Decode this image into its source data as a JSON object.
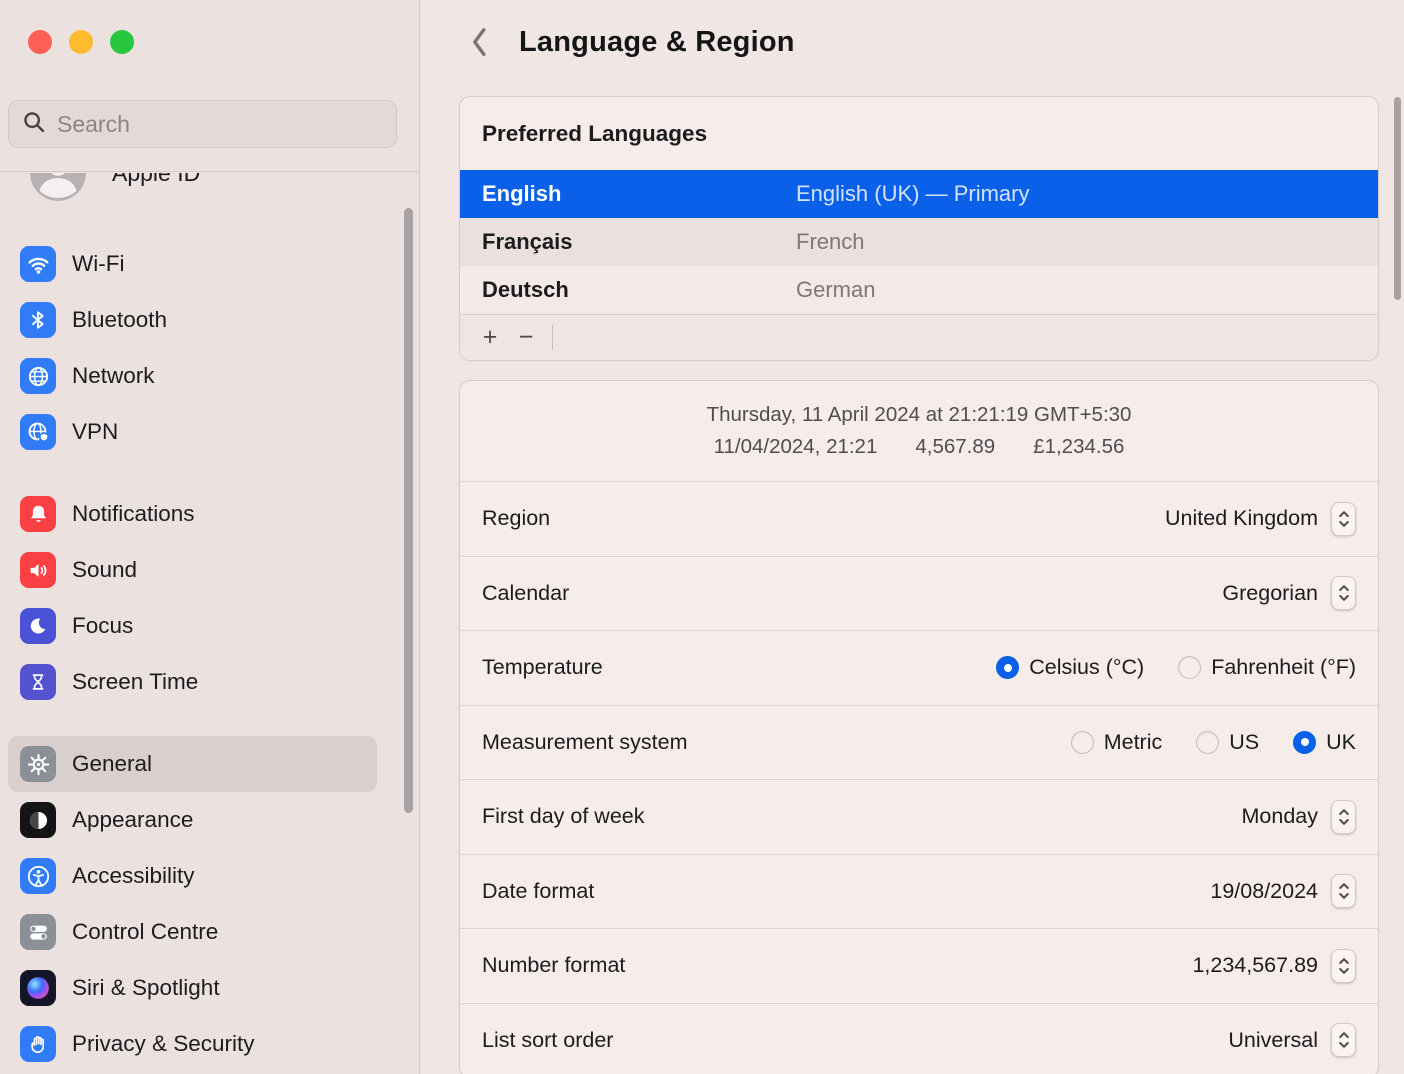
{
  "colors": {
    "accent": "#0a60e8",
    "traffic": [
      "#fe5f57",
      "#febb2e",
      "#27c83f"
    ],
    "selected_sidebar": "#d9d0ce"
  },
  "sidebar": {
    "search": {
      "placeholder": "Search"
    },
    "apple_id": {
      "label": "Apple ID"
    },
    "groups": [
      {
        "items": [
          {
            "id": "wifi",
            "label": "Wi-Fi",
            "icon": "wifi",
            "color": "#2f7cf6"
          },
          {
            "id": "bluetooth",
            "label": "Bluetooth",
            "icon": "bluetooth",
            "color": "#2f7cf6"
          },
          {
            "id": "network",
            "label": "Network",
            "icon": "globe",
            "color": "#2f7cf6"
          },
          {
            "id": "vpn",
            "label": "VPN",
            "icon": "vpn",
            "color": "#2f7cf6"
          }
        ]
      },
      {
        "items": [
          {
            "id": "notifications",
            "label": "Notifications",
            "icon": "bell",
            "color": "#fb4044"
          },
          {
            "id": "sound",
            "label": "Sound",
            "icon": "speaker",
            "color": "#fb4044"
          },
          {
            "id": "focus",
            "label": "Focus",
            "icon": "moon",
            "color": "#4a52d8"
          },
          {
            "id": "screen-time",
            "label": "Screen Time",
            "icon": "hourglass",
            "color": "#5453cf"
          }
        ]
      },
      {
        "items": [
          {
            "id": "general",
            "label": "General",
            "icon": "gear",
            "color": "#8b9096",
            "selected": true
          },
          {
            "id": "appearance",
            "label": "Appearance",
            "icon": "appearance",
            "color": "#141416"
          },
          {
            "id": "accessibility",
            "label": "Accessibility",
            "icon": "accessibility",
            "color": "#2f7cf6"
          },
          {
            "id": "control-centre",
            "label": "Control Centre",
            "icon": "toggles",
            "color": "#8b9096"
          },
          {
            "id": "siri",
            "label": "Siri & Spotlight",
            "icon": "siri",
            "color": "#14142a"
          },
          {
            "id": "privacy",
            "label": "Privacy & Security",
            "icon": "hand",
            "color": "#2f7cf6"
          }
        ]
      }
    ]
  },
  "main": {
    "header": {
      "title": "Language & Region"
    },
    "preferred_languages": {
      "title": "Preferred Languages",
      "languages": [
        {
          "name": "English",
          "detail": "English (UK) — Primary",
          "selected": true
        },
        {
          "name": "Français",
          "detail": "French",
          "selected": false
        },
        {
          "name": "Deutsch",
          "detail": "German",
          "selected": false
        }
      ],
      "toolbar": {
        "add": "+",
        "remove": "−"
      }
    },
    "formats": {
      "preview_line1": "Thursday, 11 April 2024 at 21:21:19 GMT+5:30",
      "preview_parts": [
        "11/04/2024, 21:21",
        "4,567.89",
        "£1,234.56"
      ],
      "rows": [
        {
          "label": "Region",
          "type": "stepper",
          "value": "United Kingdom"
        },
        {
          "label": "Calendar",
          "type": "stepper",
          "value": "Gregorian"
        },
        {
          "label": "Temperature",
          "type": "radio",
          "options": [
            {
              "label": "Celsius (°C)",
              "selected": true
            },
            {
              "label": "Fahrenheit (°F)",
              "selected": false
            }
          ]
        },
        {
          "label": "Measurement system",
          "type": "radio",
          "options": [
            {
              "label": "Metric",
              "selected": false
            },
            {
              "label": "US",
              "selected": false
            },
            {
              "label": "UK",
              "selected": true
            }
          ]
        },
        {
          "label": "First day of week",
          "type": "stepper",
          "value": "Monday"
        },
        {
          "label": "Date format",
          "type": "stepper",
          "value": "19/08/2024"
        },
        {
          "label": "Number format",
          "type": "stepper",
          "value": "1,234,567.89"
        },
        {
          "label": "List sort order",
          "type": "stepper",
          "value": "Universal"
        }
      ]
    }
  }
}
